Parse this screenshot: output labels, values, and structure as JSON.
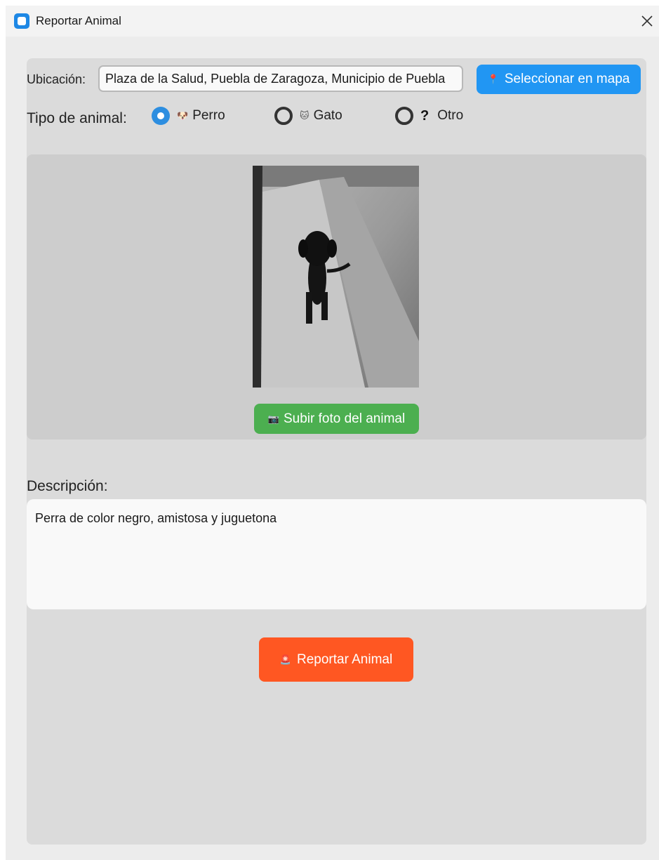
{
  "window": {
    "title": "Reportar Animal"
  },
  "location": {
    "label": "Ubicación:",
    "value": "Plaza de la Salud, Puebla de Zaragoza, Municipio de Puebla",
    "map_button_icon": "📍",
    "map_button_label": "Seleccionar en mapa"
  },
  "animal_type": {
    "label": "Tipo de animal:",
    "options": [
      {
        "icon": "🐶",
        "label": "Perro",
        "selected": true
      },
      {
        "icon": "🐱",
        "label": "Gato",
        "selected": false
      },
      {
        "icon": "?",
        "label": "Otro",
        "selected": false
      }
    ]
  },
  "photo": {
    "upload_icon": "📷",
    "upload_label": "Subir foto del animal"
  },
  "description": {
    "label": "Descripción:",
    "value": "Perra de color negro, amistosa y juguetona"
  },
  "submit": {
    "icon": "🚨",
    "label": "Reportar Animal"
  },
  "colors": {
    "map_button": "#2196f3",
    "upload_button": "#4caf50",
    "report_button": "#ff5722",
    "radio_selected": "#2d8ee0"
  }
}
